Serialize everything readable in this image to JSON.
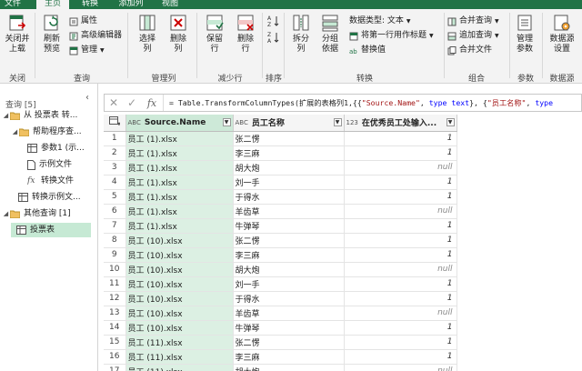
{
  "tabs": [
    "文件",
    "主页",
    "转换",
    "添加列",
    "视图"
  ],
  "ribbon": {
    "close_load": [
      "关闭并",
      "上载"
    ],
    "refresh": [
      "刷新",
      "预览"
    ],
    "properties": "属性",
    "advanced_editor": "高级编辑器",
    "manage": "管理",
    "choose_cols": [
      "选择",
      "列"
    ],
    "remove_cols": [
      "删除",
      "列"
    ],
    "keep_rows": [
      "保留",
      "行"
    ],
    "remove_rows": [
      "删除",
      "行"
    ],
    "split_col": [
      "拆分",
      "列"
    ],
    "group_by": [
      "分组",
      "依据"
    ],
    "data_type": "数据类型: 文本",
    "first_row_header": "将第一行用作标题",
    "replace_values": "替换值",
    "merge_queries": "合并查询",
    "append_queries": "追加查询",
    "combine_files": "合并文件",
    "manage_params": [
      "管理",
      "参数"
    ],
    "datasource_settings": [
      "数据源",
      "设置"
    ],
    "groups": {
      "close": "关闭",
      "query": "查询",
      "manage_cols": "管理列",
      "reduce_rows": "减少行",
      "sort": "排序",
      "transform": "转换",
      "combine": "组合",
      "params": "参数",
      "datasource": "数据源"
    }
  },
  "left_pane": {
    "header": "查询 [5]",
    "items": [
      {
        "label": "从 投票表 转...",
        "icon": "folder-icon",
        "level": 0
      },
      {
        "label": "帮助程序查...",
        "icon": "folder-icon",
        "level": 1
      },
      {
        "label": "参数1 (示...",
        "icon": "table-icon",
        "level": 2
      },
      {
        "label": "示例文件",
        "icon": "file-icon",
        "level": 2
      },
      {
        "label": "转换文件",
        "icon": "fx-icon",
        "level": 2
      },
      {
        "label": "转换示例文...",
        "icon": "table-icon",
        "level": 1
      },
      {
        "label": "其他查询 [1]",
        "icon": "folder-icon",
        "level": 0
      },
      {
        "label": "投票表",
        "icon": "table-icon",
        "level": 1,
        "selected": true
      }
    ]
  },
  "formula": {
    "prefix": "= Table.TransformColumnTypes(扩展的表格列1,{{",
    "s1": "\"Source.Name\"",
    "mid1": ", ",
    "k1": "type text",
    "mid2": "}, {",
    "s2": "\"员工名称\"",
    "mid3": ", ",
    "k2": "type"
  },
  "grid": {
    "columns": [
      {
        "type": "ABC",
        "name": "Source.Name"
      },
      {
        "type": "ABC",
        "name": "员工名称"
      },
      {
        "type": "123",
        "name": "在优秀员工处输入..."
      }
    ],
    "rows": [
      [
        "1",
        "员工 (1).xlsx",
        "张二愣",
        "1"
      ],
      [
        "2",
        "员工 (1).xlsx",
        "李三麻",
        "1"
      ],
      [
        "3",
        "员工 (1).xlsx",
        "胡大炮",
        "null"
      ],
      [
        "4",
        "员工 (1).xlsx",
        "刘一手",
        "1"
      ],
      [
        "5",
        "员工 (1).xlsx",
        "于得水",
        "1"
      ],
      [
        "6",
        "员工 (1).xlsx",
        "羊齿草",
        "null"
      ],
      [
        "7",
        "员工 (1).xlsx",
        "牛弹琴",
        "1"
      ],
      [
        "8",
        "员工 (10).xlsx",
        "张二愣",
        "1"
      ],
      [
        "9",
        "员工 (10).xlsx",
        "李三麻",
        "1"
      ],
      [
        "10",
        "员工 (10).xlsx",
        "胡大炮",
        "null"
      ],
      [
        "11",
        "员工 (10).xlsx",
        "刘一手",
        "1"
      ],
      [
        "12",
        "员工 (10).xlsx",
        "于得水",
        "1"
      ],
      [
        "13",
        "员工 (10).xlsx",
        "羊齿草",
        "null"
      ],
      [
        "14",
        "员工 (10).xlsx",
        "牛弹琴",
        "1"
      ],
      [
        "15",
        "员工 (11).xlsx",
        "张二愣",
        "1"
      ],
      [
        "16",
        "员工 (11).xlsx",
        "李三麻",
        "1"
      ],
      [
        "17",
        "员工 (11).xlsx",
        "胡大炮",
        "null"
      ]
    ]
  },
  "colors": {
    "accent": "#217346",
    "selected_col": "#dcf0e3",
    "selected_query": "#c6e9d4"
  }
}
